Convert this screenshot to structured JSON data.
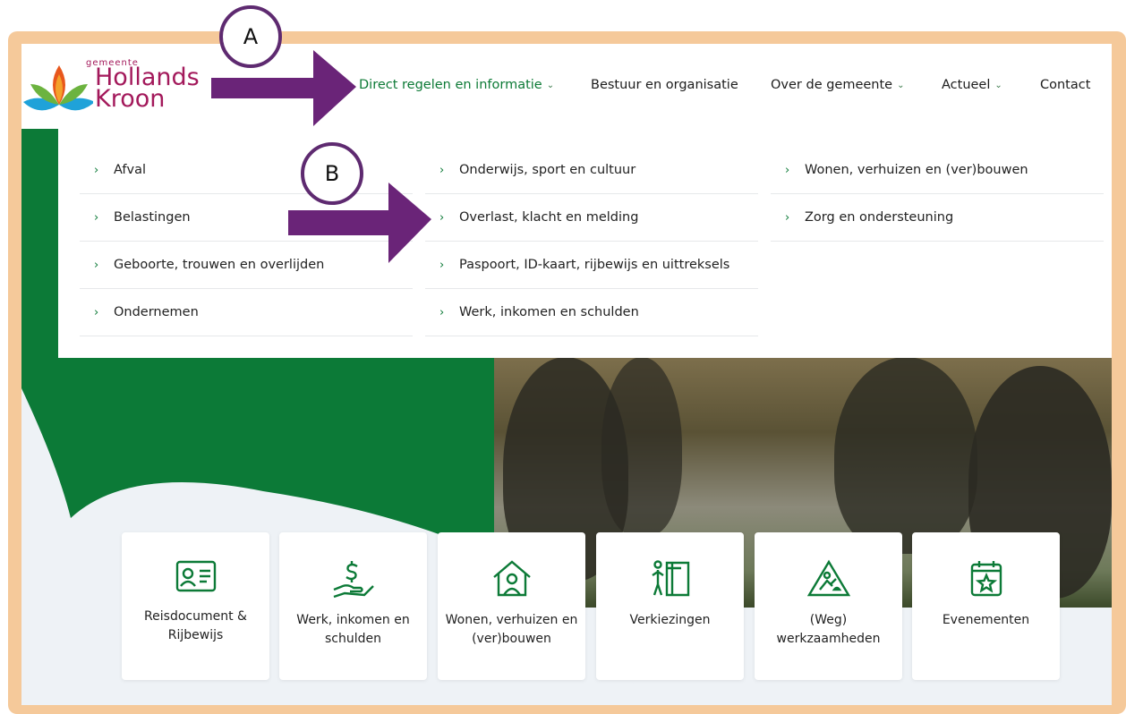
{
  "logo": {
    "top_text": "gemeente",
    "name_line1": "Hollands",
    "name_line2": "Kroon"
  },
  "nav": {
    "items": [
      {
        "label": "Direct regelen en informatie",
        "has_chevron": true,
        "active": true
      },
      {
        "label": "Bestuur en organisatie",
        "has_chevron": false
      },
      {
        "label": "Over de gemeente",
        "has_chevron": true
      },
      {
        "label": "Actueel",
        "has_chevron": true
      },
      {
        "label": "Contact",
        "has_chevron": false
      }
    ]
  },
  "dropdown": {
    "col1": [
      "Afval",
      "Belastingen",
      "Geboorte, trouwen en overlijden",
      "Ondernemen"
    ],
    "col2": [
      "Onderwijs, sport en cultuur",
      "Overlast, klacht en melding",
      "Paspoort, ID-kaart, rijbewijs en uittreksels",
      "Werk, inkomen en schulden"
    ],
    "col3": [
      "Wonen, verhuizen en (ver)bouwen",
      "Zorg en ondersteuning"
    ]
  },
  "cards": [
    {
      "label": "Reisdocument & Rijbewijs",
      "icon": "id-card-icon"
    },
    {
      "label": "Werk, inkomen en schulden",
      "icon": "money-hand-icon"
    },
    {
      "label": "Wonen, verhuizen en (ver)bouwen",
      "icon": "house-person-icon"
    },
    {
      "label": "Verkiezingen",
      "icon": "voting-booth-icon"
    },
    {
      "label": "(Weg) werkzaamheden",
      "icon": "road-works-icon"
    },
    {
      "label": "Evenementen",
      "icon": "calendar-star-icon"
    }
  ],
  "annotations": {
    "a": "A",
    "b": "B"
  },
  "colors": {
    "brand_green": "#0c7a37",
    "brand_magenta": "#a3195b",
    "annotation_purple": "#6a2478"
  }
}
